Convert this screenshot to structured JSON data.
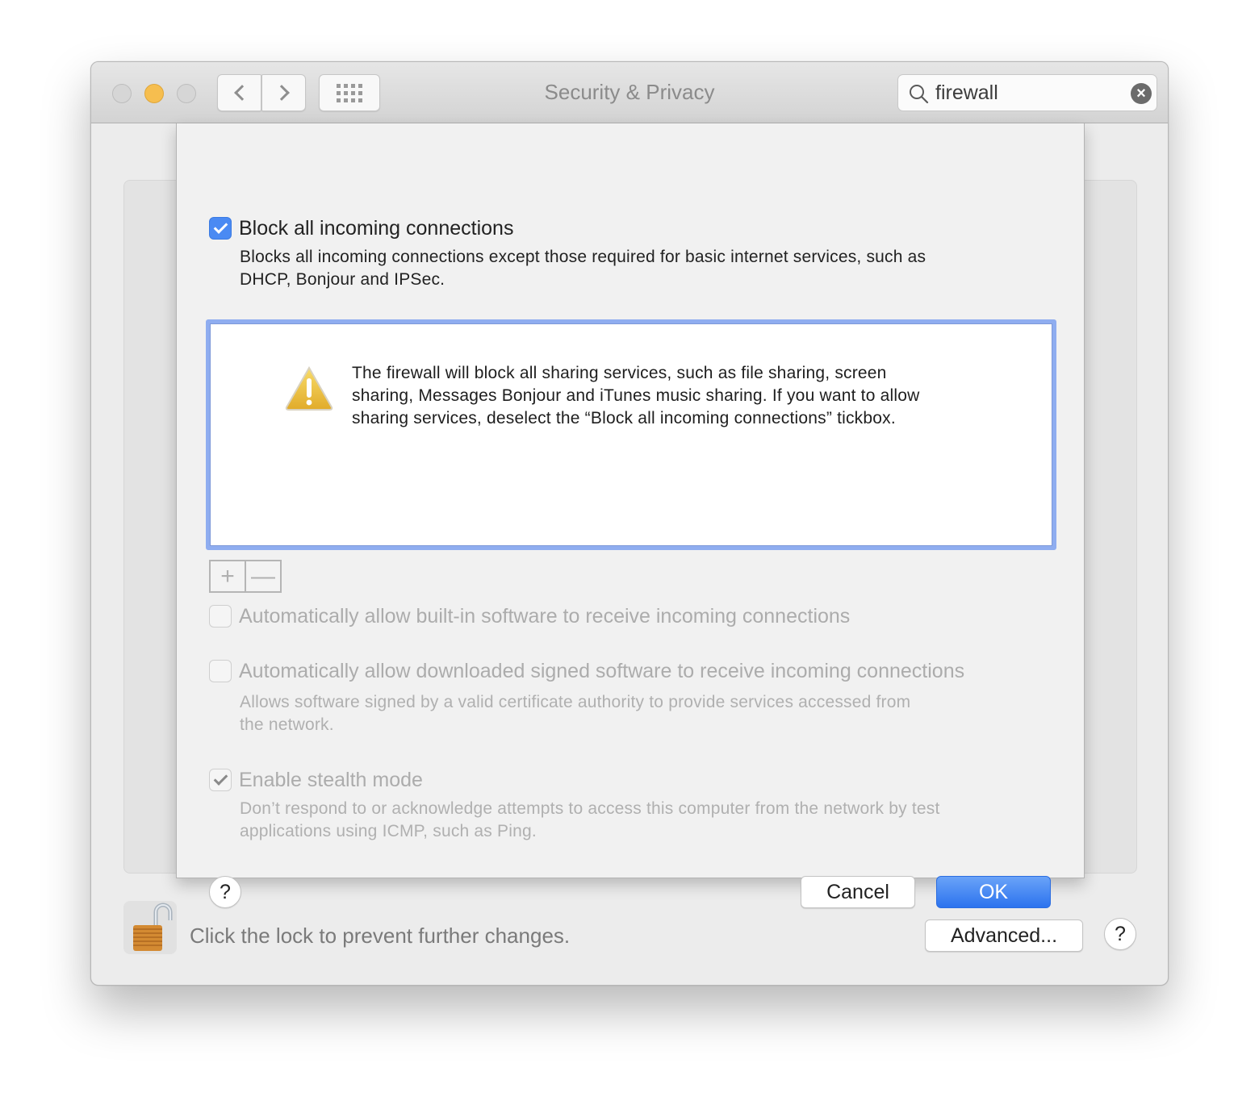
{
  "window": {
    "title": "Security & Privacy",
    "traffic_lights": [
      "close",
      "minimize",
      "zoom"
    ],
    "nav": {
      "back_icon": "chevron-left",
      "forward_icon": "chevron-right",
      "show_all_icon": "grid"
    }
  },
  "search": {
    "value": "firewall",
    "placeholder": "Search",
    "icon": "search-icon",
    "clear_icon": "clear-icon"
  },
  "sheet": {
    "block_all": {
      "label": "Block all incoming connections",
      "checked": true,
      "description_line1": "Blocks all incoming connections except those required for basic internet services, such as",
      "description_line2": "DHCP, Bonjour and IPSec."
    },
    "warning": {
      "icon": "warning-icon",
      "line1": "The firewall will block all sharing services, such as file sharing, screen",
      "line2": "sharing, Messages Bonjour and iTunes music sharing. If you want to allow",
      "line3": "sharing services, deselect the “Block all incoming connections” tickbox."
    },
    "add_label": "+",
    "remove_label": "—",
    "auto_builtin": {
      "label": "Automatically allow built-in software to receive incoming connections",
      "checked": false,
      "enabled": false
    },
    "auto_signed": {
      "label": "Automatically allow downloaded signed software to receive incoming connections",
      "checked": false,
      "enabled": false,
      "description_line1": "Allows software signed by a valid certificate authority to provide services accessed from",
      "description_line2": "the network."
    },
    "stealth": {
      "label": "Enable stealth mode",
      "checked": true,
      "enabled": false,
      "description_line1": "Don’t respond to or acknowledge attempts to access this computer from the network by test",
      "description_line2": "applications using ICMP, such as Ping."
    },
    "help_label": "?",
    "cancel_label": "Cancel",
    "ok_label": "OK"
  },
  "footer": {
    "lock_text": "Click the lock to prevent further changes.",
    "lock_state": "unlocked",
    "advanced_label": "Advanced...",
    "help_label": "?"
  },
  "colors": {
    "accent": "#2c73ee",
    "checkbox_on": "#4a8af3",
    "focus_ring": "#8fadf0",
    "minimize": "#f6be4f"
  }
}
